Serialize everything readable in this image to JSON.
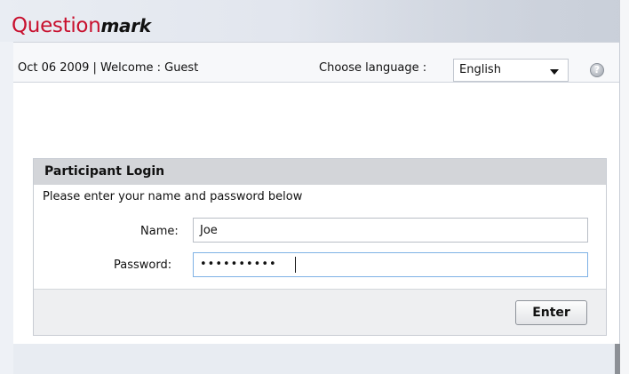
{
  "header": {
    "logo_prefix": "Question",
    "logo_suffix": "mark"
  },
  "topbar": {
    "date_welcome": "Oct 06 2009 | Welcome : Guest",
    "language_label": "Choose language :",
    "language_value": "English",
    "help_icon": "question-mark-icon"
  },
  "login": {
    "title": "Participant Login",
    "instructions": "Please enter your name and password below",
    "name_label": "Name:",
    "name_value": "Joe",
    "password_label": "Password:",
    "password_value": "••••••••••",
    "enter_label": "Enter"
  },
  "colors": {
    "logo_red": "#c8102e",
    "panel_header": "#d3d5d9",
    "focus_border": "#7fb2e5"
  }
}
